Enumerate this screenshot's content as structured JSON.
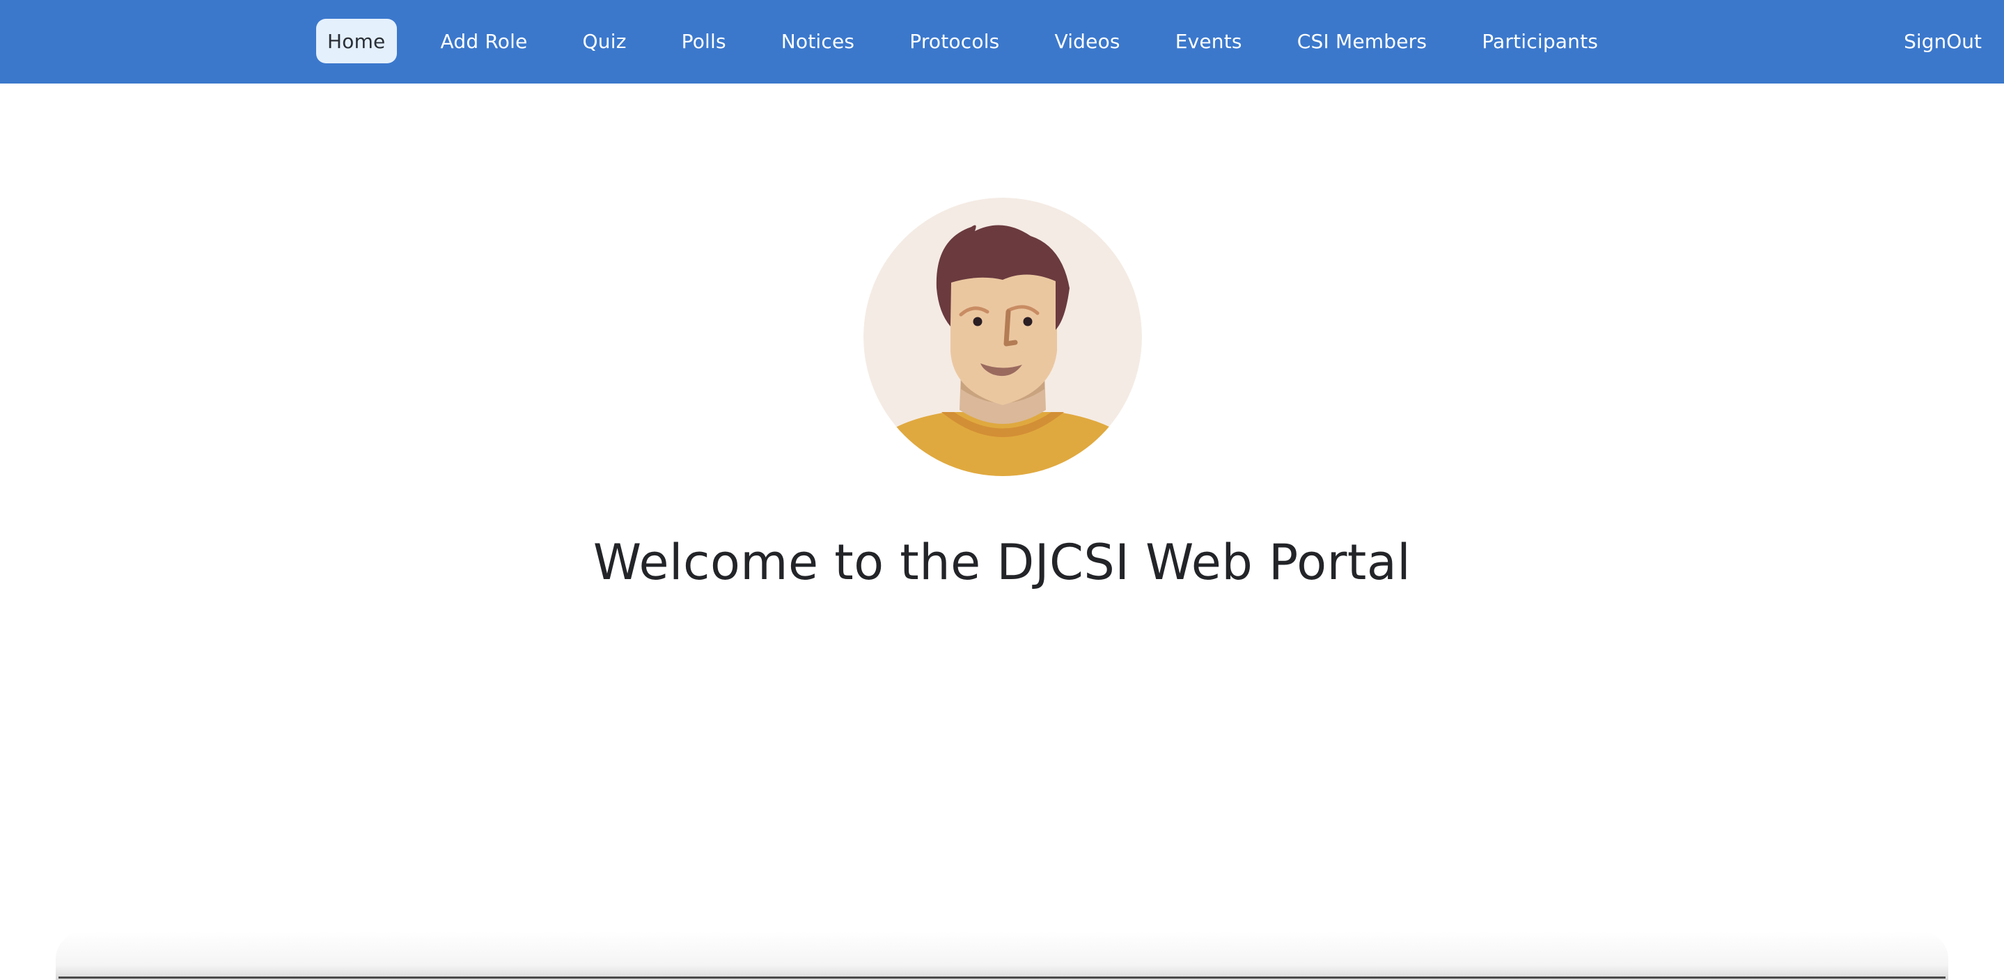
{
  "nav": {
    "items": [
      {
        "label": "Home",
        "active": true
      },
      {
        "label": "Add Role",
        "active": false
      },
      {
        "label": "Quiz",
        "active": false
      },
      {
        "label": "Polls",
        "active": false
      },
      {
        "label": "Notices",
        "active": false
      },
      {
        "label": "Protocols",
        "active": false
      },
      {
        "label": "Videos",
        "active": false
      },
      {
        "label": "Events",
        "active": false
      },
      {
        "label": "CSI Members",
        "active": false
      },
      {
        "label": "Participants",
        "active": false
      }
    ],
    "signout_label": "SignOut"
  },
  "main": {
    "welcome_text": "Welcome to the DJCSI Web Portal",
    "avatar_icon": "user-avatar-icon"
  },
  "colors": {
    "navbar_bg": "#3b78cc",
    "active_tab_bg": "#e4f0fc",
    "avatar_bg": "#f4ebe4",
    "shirt": "#e0a93f",
    "hair": "#6a3a3f",
    "skin": "#ebc7a0"
  }
}
